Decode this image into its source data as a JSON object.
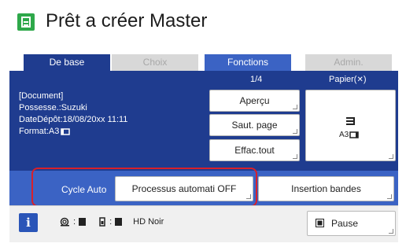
{
  "header": {
    "title": "Prêt a créer Master",
    "icon": "master-sheet-icon"
  },
  "tabs": [
    {
      "label": "De base",
      "state": "active"
    },
    {
      "label": "Choix",
      "state": "disabled"
    },
    {
      "label": "Fonctions",
      "state": "enabled"
    },
    {
      "label": "Admin.",
      "state": "disabled"
    }
  ],
  "document": {
    "heading": "[Document]",
    "owner": "Possesse.:Suzuki",
    "date": "DateDépôt:18/08/20xx 11:11",
    "format": "Format:A3"
  },
  "pager": "1/4",
  "paper": {
    "label": "Papier(",
    "symbol": "✕",
    "close": ")",
    "size": "A3"
  },
  "buttons": {
    "preview": "Aperçu",
    "page_skip": "Saut. page",
    "clear_all": "Effac.tout"
  },
  "bar": {
    "auto_label": "Cycle Auto",
    "auto_value": "Processus automati OFF",
    "insert_strips": "Insertion bandes"
  },
  "footer": {
    "info": "i",
    "drum_sep": ":",
    "ink_sep": ":",
    "ink_name": "HD Noir",
    "pause": "Pause"
  },
  "colors": {
    "tab_active": "#1f3c8f",
    "tab_blue": "#3b63c4",
    "highlight": "#d8202a",
    "icon_green": "#2ea84a"
  }
}
